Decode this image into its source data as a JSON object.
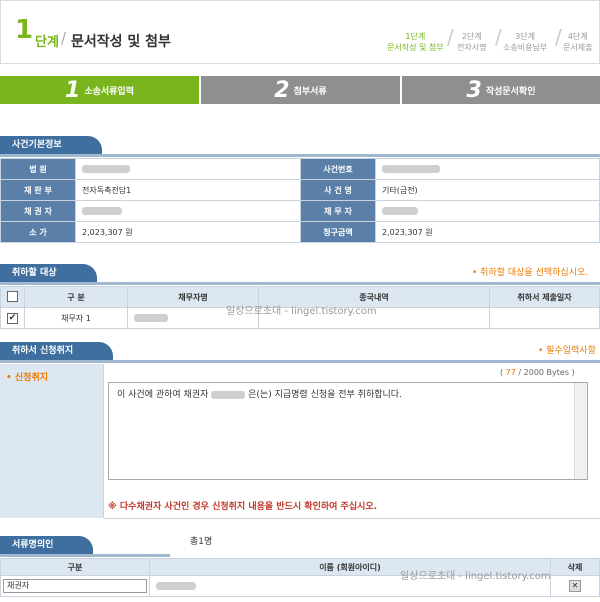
{
  "header": {
    "step_num": "1",
    "step_word": "단계",
    "title": "문서작성 및 첨부",
    "steps": [
      {
        "line1": "1단계",
        "line2": "문서작성 및 첨부"
      },
      {
        "line1": "2단계",
        "line2": "전자서명"
      },
      {
        "line1": "3단계",
        "line2": "소송비용납부"
      },
      {
        "line1": "4단계",
        "line2": "문서제출"
      }
    ]
  },
  "tabs": [
    {
      "num": "1",
      "label": "소송서류입력",
      "color": "#7ab51d"
    },
    {
      "num": "2",
      "label": "첨부서류",
      "color": "#8f8f8f"
    },
    {
      "num": "3",
      "label": "작성문서확인",
      "color": "#8f8f8f"
    }
  ],
  "case_info": {
    "title": "사건기본정보",
    "court_label": "법 원",
    "case_no_label": "사건번호",
    "judge_label": "재 판 부",
    "judge_value": "전자독촉전담1",
    "case_name_label": "사 건 명",
    "case_name_value": "기타(금전)",
    "creditor_label": "채 권 자",
    "debtor_label": "채 무 자",
    "value_label": "소 가",
    "value_value": "2,023,307 원",
    "claim_label": "청구금액",
    "claim_value": "2,023,307 원"
  },
  "withdraw_target": {
    "title": "취하할 대상",
    "note": "• 취하할 대상을 선택하십시오.",
    "col_type": "구 분",
    "col_debtor": "채무자명",
    "col_result": "종국내역",
    "col_date": "취하서 제출일자",
    "row_type": "채무자 1"
  },
  "reason": {
    "title": "취하서 신청취지",
    "note": "• 필수입력사항",
    "label": "• 신청취지",
    "counter_open": "( ",
    "counter_value": "77",
    "counter_close": " / 2000 Bytes )",
    "text_prefix": "이 사건에 관하여 채권자",
    "text_suffix": "은(는) 지급명령 신청을 전부 취하합니다.",
    "warning": "※ 다수채권자 사건인 경우 신청취지 내용을 반드시 확인하여 주십시오."
  },
  "signers": {
    "title": "서류명의인",
    "count": "총1명",
    "col_type": "구분",
    "col_name": "이름 (회원아이디)",
    "col_delete": "삭제",
    "row_type": "채권자"
  },
  "watermark": {
    "text": "일상으로초대 - lingel.tistory.com"
  }
}
